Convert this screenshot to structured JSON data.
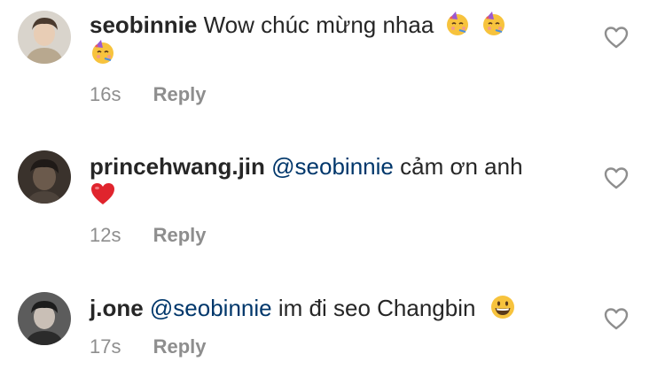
{
  "comments": [
    {
      "username": "seobinnie",
      "text": "Wow chúc mừng nhaa",
      "emoji": [
        "partying-face",
        "partying-face",
        "partying-face"
      ],
      "time": "16s",
      "reply_label": "Reply"
    },
    {
      "username": "princehwang.jin",
      "mention": "@seobinnie",
      "text": "cảm ơn anh",
      "emoji": [
        "red-heart"
      ],
      "time": "12s",
      "reply_label": "Reply"
    },
    {
      "username": "j.one",
      "mention": "@seobinnie",
      "text": "im đi seo Changbin",
      "emoji": [
        "grinning-face"
      ],
      "time": "17s",
      "reply_label": "Reply"
    }
  ],
  "colors": {
    "username": "#262626",
    "mention": "#00376b",
    "meta": "#8e8e8e",
    "heart_outline": "#8e8e8e"
  },
  "icons": [
    "heart-outline-icon",
    "partying-face-emoji",
    "red-heart-emoji",
    "grinning-face-emoji"
  ]
}
